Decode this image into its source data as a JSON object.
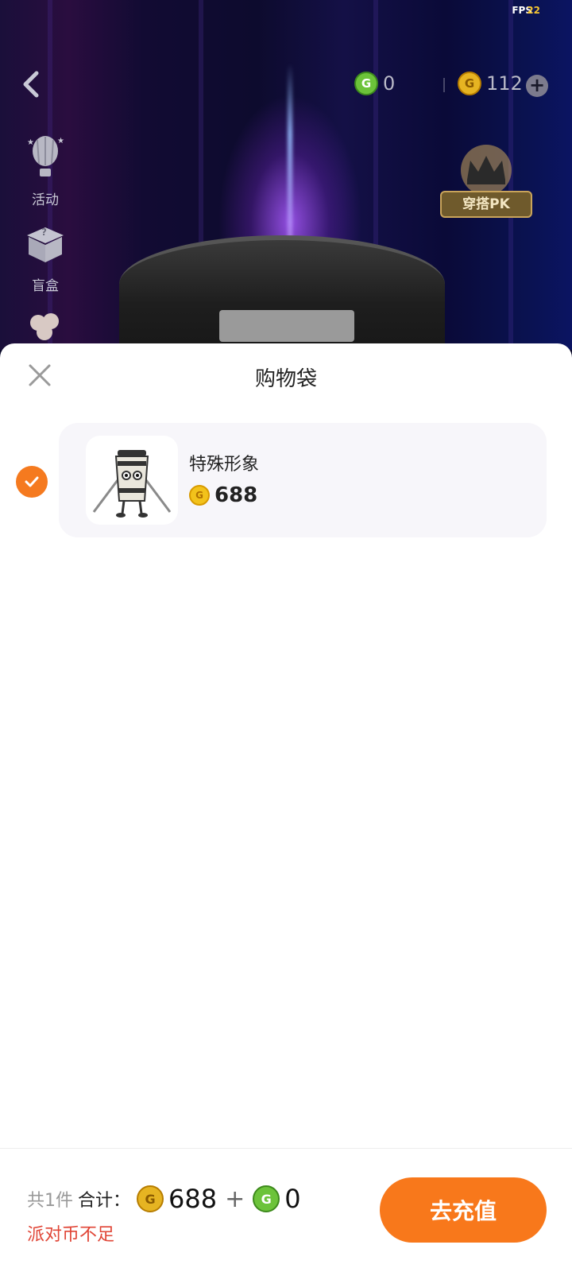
{
  "status": {
    "fps_label": "FPS",
    "fps_value": "22"
  },
  "header": {
    "green_coin_balance": "0",
    "gold_coin_balance": "112"
  },
  "sidebar": {
    "items": [
      {
        "label": "活动",
        "icon": "hot-air-balloon-icon"
      },
      {
        "label": "盲盒",
        "icon": "mystery-box-icon"
      },
      {
        "label": "",
        "icon": "flower-icon"
      }
    ]
  },
  "pk_badge": {
    "label": "穿搭PK",
    "icon": "crown-icon"
  },
  "sheet": {
    "title": "购物袋",
    "items": [
      {
        "name": "特殊形象",
        "price": "688",
        "selected": true
      }
    ]
  },
  "footer": {
    "count_label": "共1件",
    "total_label": "合计：",
    "gold_total": "688",
    "plus": "+",
    "green_total": "0",
    "warning": "派对币不足",
    "recharge_label": "去充值"
  },
  "colors": {
    "accent_orange": "#f8781b",
    "warning_red": "#e04536",
    "gold_coin": "#f2c21b",
    "green_coin": "#6cc33a"
  }
}
